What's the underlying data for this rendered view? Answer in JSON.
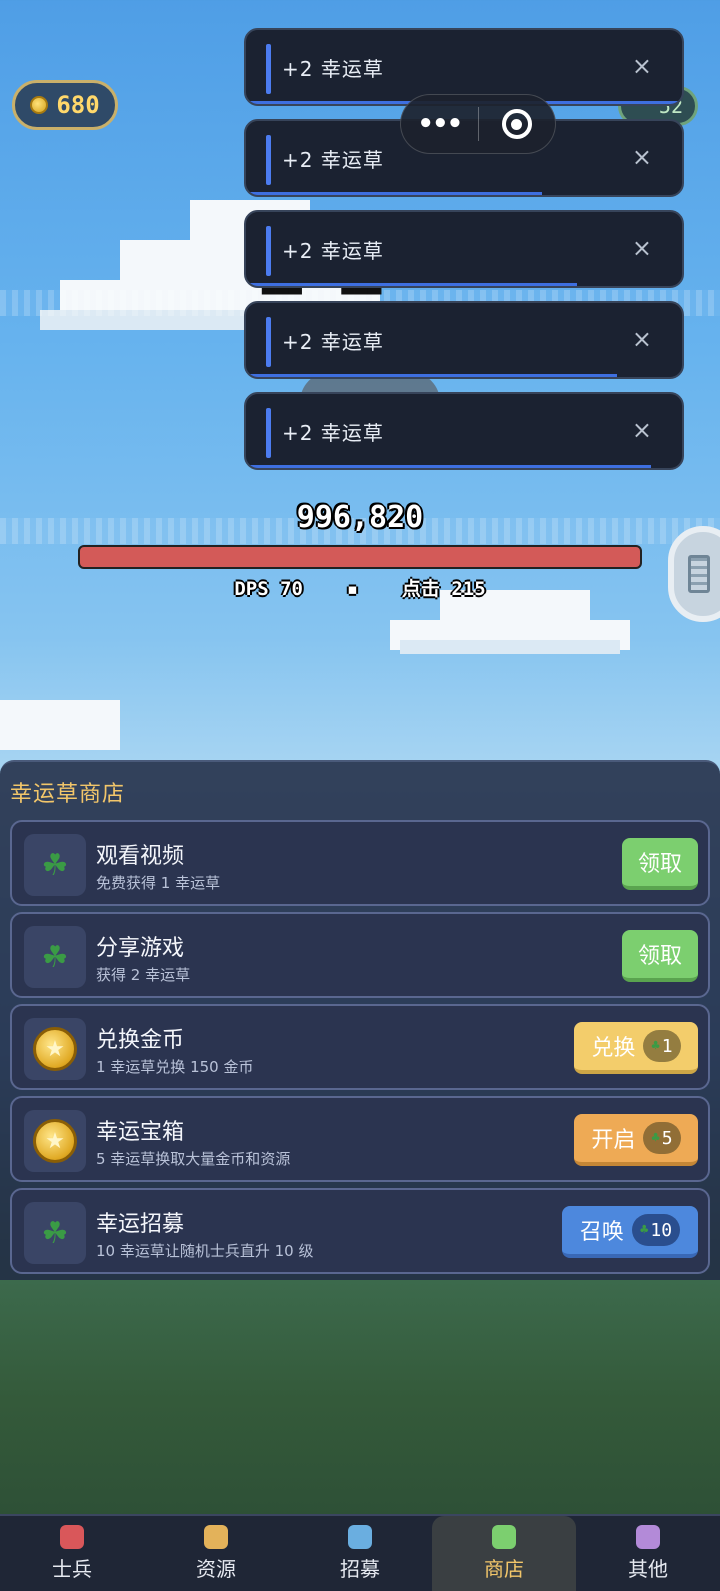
{
  "hud": {
    "coins": "680",
    "clover_count": "52"
  },
  "toasts": [
    {
      "text": "+2 幸运草",
      "progress": 1.0
    },
    {
      "text": "+2 幸运草",
      "progress": 0.68
    },
    {
      "text": "+2 幸运草",
      "progress": 0.76
    },
    {
      "text": "+2 幸运草",
      "progress": 0.85
    },
    {
      "text": "+2 幸运草",
      "progress": 0.93
    }
  ],
  "toast_close": "×",
  "capsule": {
    "more": "•••"
  },
  "enemy": {
    "hp": "996,820",
    "hp_fraction": 1.0,
    "dps_label": "DPS 70",
    "separator": "▪",
    "click_label": "点击 215"
  },
  "shop": {
    "title": "幸运草商店",
    "items": [
      {
        "name": "观看视频",
        "desc": "免费获得 1 幸运草",
        "icon": "clover-icon",
        "button": "领取",
        "cost": ""
      },
      {
        "name": "分享游戏",
        "desc": "获得 2 幸运草",
        "icon": "clover-icon",
        "button": "领取",
        "cost": ""
      },
      {
        "name": "兑换金币",
        "desc": "1 幸运草兑换 150 金币",
        "icon": "gold-coin-icon",
        "button": "兑换",
        "cost": "1"
      },
      {
        "name": "幸运宝箱",
        "desc": "5 幸运草换取大量金币和资源",
        "icon": "gold-coin-icon",
        "button": "开启",
        "cost": "5"
      },
      {
        "name": "幸运招募",
        "desc": "10 幸运草让随机士兵直升 10 级",
        "icon": "clover-icon",
        "button": "召唤",
        "cost": "10"
      }
    ]
  },
  "nav": [
    {
      "label": "士兵",
      "color": "#d9575a"
    },
    {
      "label": "资源",
      "color": "#e3b25a"
    },
    {
      "label": "招募",
      "color": "#6aaee0"
    },
    {
      "label": "商店",
      "color": "#7ccf6f"
    },
    {
      "label": "其他",
      "color": "#b38ad8"
    }
  ],
  "colors": {
    "accent_gold": "#f2c66a",
    "toast_bar": "#4c7cf0"
  }
}
